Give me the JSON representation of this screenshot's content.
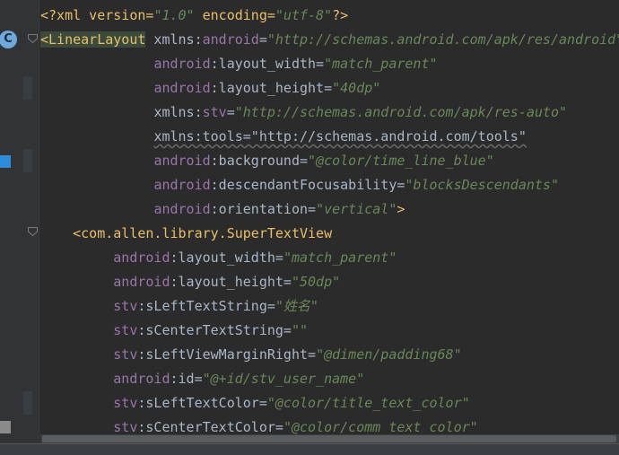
{
  "editor": {
    "lines": [
      {
        "indent": "",
        "parts": [
          [
            "pi",
            "<?xml version="
          ],
          [
            "attr-v",
            "\"1.0\""
          ],
          [
            "pi",
            " encoding="
          ],
          [
            "attr-v",
            "\"utf-8\""
          ],
          [
            "pi",
            "?>"
          ]
        ]
      },
      {
        "indent": "",
        "parts": [
          [
            "tagname hl",
            "<LinearLayout"
          ],
          [
            "name",
            " xmlns:"
          ],
          [
            "ns",
            "android"
          ],
          [
            "eq",
            "="
          ],
          [
            "attr-v",
            "\"http://schemas.android.com/apk/res/android\""
          ]
        ]
      },
      {
        "indent": "              ",
        "parts": [
          [
            "ns",
            "android"
          ],
          [
            "name",
            ":layout_width="
          ],
          [
            "attr-v",
            "\"match_parent\""
          ]
        ]
      },
      {
        "indent": "              ",
        "parts": [
          [
            "ns",
            "android"
          ],
          [
            "name",
            ":layout_height="
          ],
          [
            "attr-v",
            "\"40dp\""
          ]
        ]
      },
      {
        "indent": "              ",
        "parts": [
          [
            "name",
            "xmlns:"
          ],
          [
            "ns",
            "stv"
          ],
          [
            "eq",
            "="
          ],
          [
            "attr-v",
            "\"http://schemas.android.com/apk/res-auto\""
          ]
        ]
      },
      {
        "indent": "              ",
        "parts": [
          [
            "name tools",
            "xmlns:tools=\"http://schemas.android.com/tools\""
          ]
        ]
      },
      {
        "indent": "              ",
        "parts": [
          [
            "ns",
            "android"
          ],
          [
            "name",
            ":background="
          ],
          [
            "attr-v",
            "\"@color/time_line_blue\""
          ]
        ]
      },
      {
        "indent": "              ",
        "parts": [
          [
            "ns",
            "android"
          ],
          [
            "name",
            ":descendantFocusability="
          ],
          [
            "attr-v",
            "\"blocksDescendants\""
          ]
        ]
      },
      {
        "indent": "              ",
        "parts": [
          [
            "ns",
            "android"
          ],
          [
            "name",
            ":orientation="
          ],
          [
            "attr-v",
            "\"vertical\""
          ],
          [
            "tagname",
            ">"
          ]
        ]
      },
      {
        "indent": "",
        "parts": [
          [
            "tagname",
            "    <com.allen.library.SuperTextView"
          ]
        ]
      },
      {
        "indent": "         ",
        "parts": [
          [
            "ns",
            "android"
          ],
          [
            "name",
            ":layout_width="
          ],
          [
            "attr-v",
            "\"match_parent\""
          ]
        ]
      },
      {
        "indent": "         ",
        "parts": [
          [
            "ns",
            "android"
          ],
          [
            "name",
            ":layout_height="
          ],
          [
            "attr-v",
            "\"50dp\""
          ]
        ]
      },
      {
        "indent": "         ",
        "parts": [
          [
            "ns",
            "stv"
          ],
          [
            "name",
            ":sLeftTextString="
          ],
          [
            "attr-v",
            "\"姓名\""
          ]
        ]
      },
      {
        "indent": "         ",
        "parts": [
          [
            "ns",
            "stv"
          ],
          [
            "name",
            ":sCenterTextString="
          ],
          [
            "attr-v",
            "\"\""
          ]
        ]
      },
      {
        "indent": "         ",
        "parts": [
          [
            "ns",
            "stv"
          ],
          [
            "name",
            ":sLeftViewMarginRight="
          ],
          [
            "attr-v",
            "\"@dimen/padding68\""
          ]
        ]
      },
      {
        "indent": "         ",
        "parts": [
          [
            "ns",
            "android"
          ],
          [
            "name",
            ":id="
          ],
          [
            "attr-v",
            "\"@+id/stv_user_name\""
          ]
        ]
      },
      {
        "indent": "         ",
        "parts": [
          [
            "ns",
            "stv"
          ],
          [
            "name",
            ":sLeftTextColor="
          ],
          [
            "attr-v",
            "\"@color/title_text_color\""
          ]
        ]
      },
      {
        "indent": "         ",
        "parts": [
          [
            "ns",
            "stv"
          ],
          [
            "name",
            ":sCenterTextColor="
          ],
          [
            "attr-v",
            "\"@color/comm_text_color\""
          ]
        ]
      }
    ]
  },
  "gutter": {
    "badge_label": "C"
  },
  "colors": {
    "background": "#2b2b2b",
    "tag": "#e8bf6a",
    "namespace": "#9876aa",
    "string": "#6a8759",
    "text": "#a9b7c6"
  }
}
